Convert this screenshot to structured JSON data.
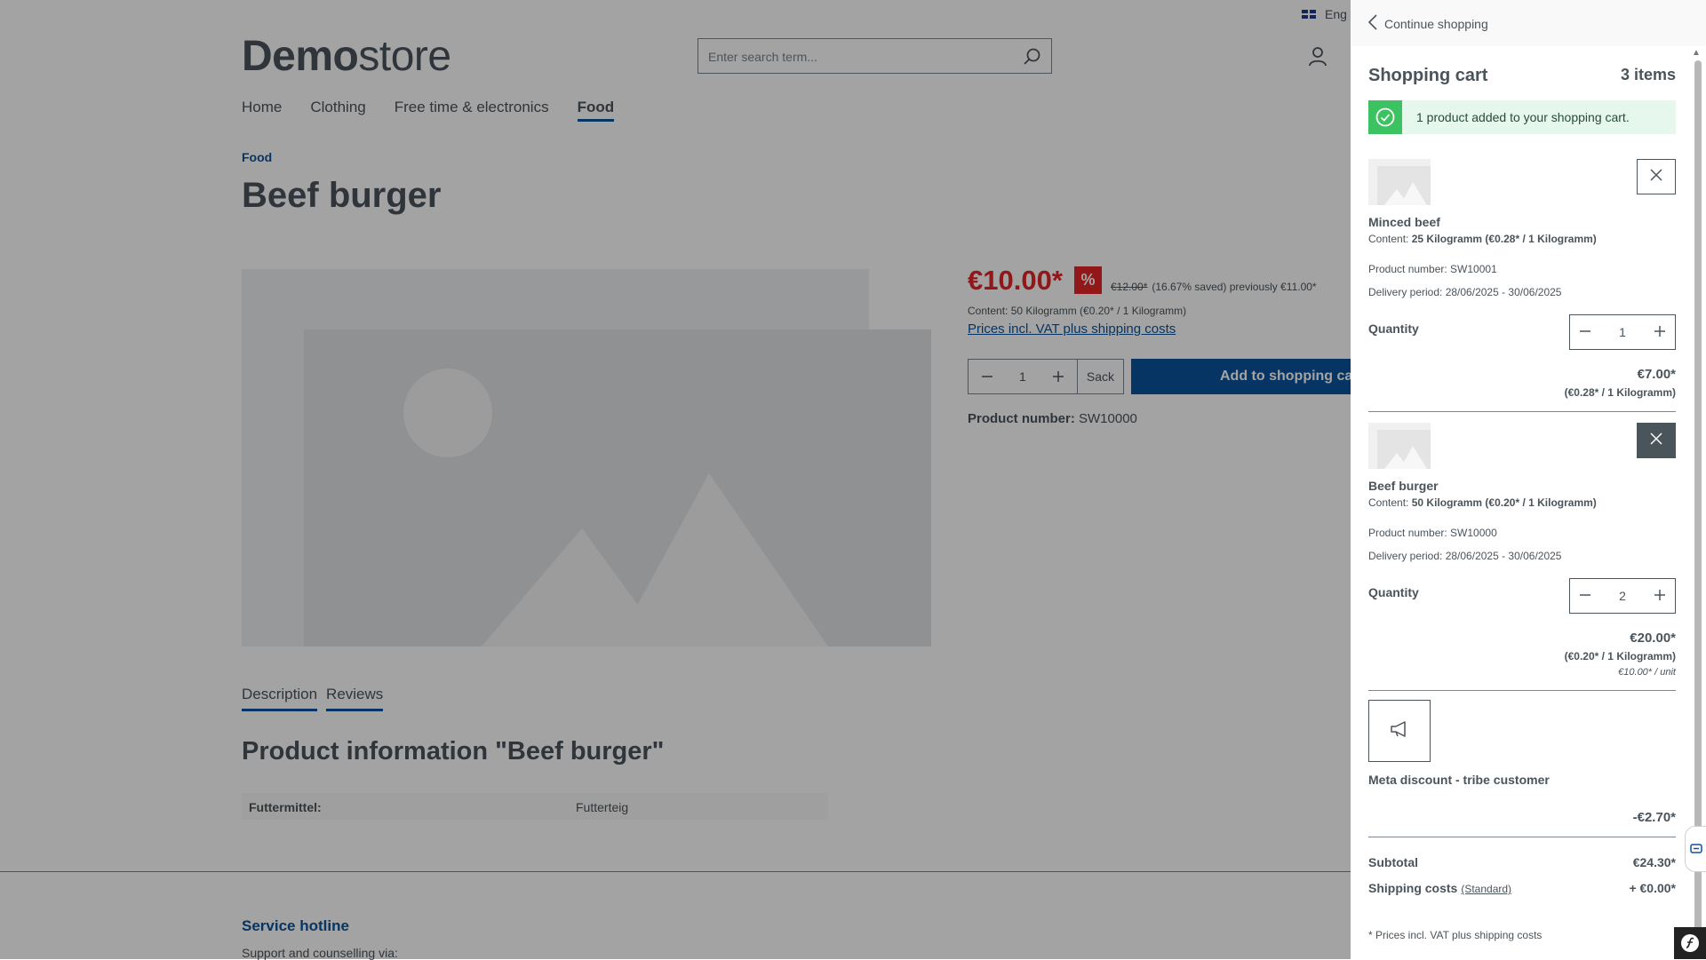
{
  "header": {
    "logo_bold": "Demo",
    "logo_light": "store",
    "search_placeholder": "Enter search term...",
    "language": "Eng",
    "icons": {
      "search": "search-icon",
      "account": "user-icon",
      "flag": "uk-flag-icon"
    }
  },
  "nav": {
    "items": [
      {
        "label": "Home"
      },
      {
        "label": "Clothing"
      },
      {
        "label": "Free time & electronics"
      },
      {
        "label": "Food",
        "active": true
      }
    ]
  },
  "breadcrumb": "Food",
  "product": {
    "title": "Beef burger",
    "price": "€10.00*",
    "discount_badge": "%",
    "old_price": "€12.00*",
    "saved": "(16.67% saved) previously €11.00*",
    "content": "Content: 50 Kilogramm (€0.20* / 1 Kilogramm)",
    "vat_link": "Prices incl. VAT plus shipping costs",
    "quantity": "1",
    "unit": "Sack",
    "add_to_cart": "Add to shopping cart",
    "product_number_label": "Product number:",
    "product_number": "SW10000"
  },
  "tabs": [
    {
      "label": "Description"
    },
    {
      "label": "Reviews"
    }
  ],
  "info": {
    "title": "Product information \"Beef burger\"",
    "properties": [
      {
        "key": "Futtermittel:",
        "value": "Futterteig"
      }
    ]
  },
  "footer": {
    "hotline_title": "Service hotline",
    "support_text": "Support and counselling via:"
  },
  "cart": {
    "continue": "Continue shopping",
    "title": "Shopping cart",
    "count": "3 items",
    "alert": "1 product added to your shopping cart.",
    "quantity_label": "Quantity",
    "items": [
      {
        "name": "Minced beef",
        "content_label": "Content:",
        "content": "25 Kilogramm (€0.28* / 1 Kilogramm)",
        "product_number": "Product number: SW10001",
        "delivery": "Delivery period: 28/06/2025 - 30/06/2025",
        "quantity": "1",
        "price": "€7.00*",
        "ref_price": "(€0.28* / 1 Kilogramm)"
      },
      {
        "name": "Beef burger",
        "content_label": "Content:",
        "content": "50 Kilogramm (€0.20* / 1 Kilogramm)",
        "product_number": "Product number: SW10000",
        "delivery": "Delivery period: 28/06/2025 - 30/06/2025",
        "quantity": "2",
        "price": "€20.00*",
        "ref_price": "(€0.20* / 1 Kilogramm)",
        "unit_price": "€10.00* / unit"
      }
    ],
    "promotion": {
      "name": "Meta discount - tribe customer",
      "price": "-€2.70*"
    },
    "subtotal_label": "Subtotal",
    "subtotal": "€24.30*",
    "shipping_label": "Shipping costs",
    "shipping_method": "(Standard)",
    "shipping": "+ €0.00*",
    "footnote": "* Prices incl. VAT plus shipping costs"
  },
  "colors": {
    "brand_blue": "#0b539b",
    "price_red": "#e52427",
    "success_green": "#3cc261",
    "text": "#4a545b"
  }
}
